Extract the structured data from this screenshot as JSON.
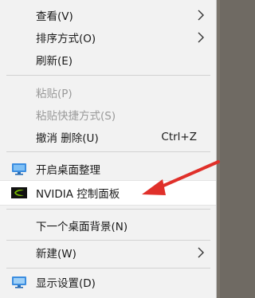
{
  "menu": {
    "items": [
      {
        "label": "查看(V)",
        "has_submenu": true
      },
      {
        "label": "排序方式(O)",
        "has_submenu": true
      },
      {
        "label": "刷新(E)"
      },
      {
        "label": "粘贴(P)",
        "disabled": true
      },
      {
        "label": "粘贴快捷方式(S)",
        "disabled": true
      },
      {
        "label": "撤消 删除(U)",
        "shortcut": "Ctrl+Z"
      },
      {
        "label": "开启桌面整理",
        "icon": "desktop-organizer-icon"
      },
      {
        "label": "NVIDIA 控制面板",
        "icon": "nvidia-logo-icon"
      },
      {
        "label": "下一个桌面背景(N)"
      },
      {
        "label": "新建(W)",
        "has_submenu": true
      },
      {
        "label": "显示设置(D)",
        "icon": "display-settings-icon"
      }
    ]
  },
  "colors": {
    "menu_bg": "#f2f2f2",
    "highlight_bg": "#ffffff",
    "disabled_text": "#9a9a9a",
    "annotation_arrow": "#e0302a",
    "nvidia_green": "#76b900"
  }
}
